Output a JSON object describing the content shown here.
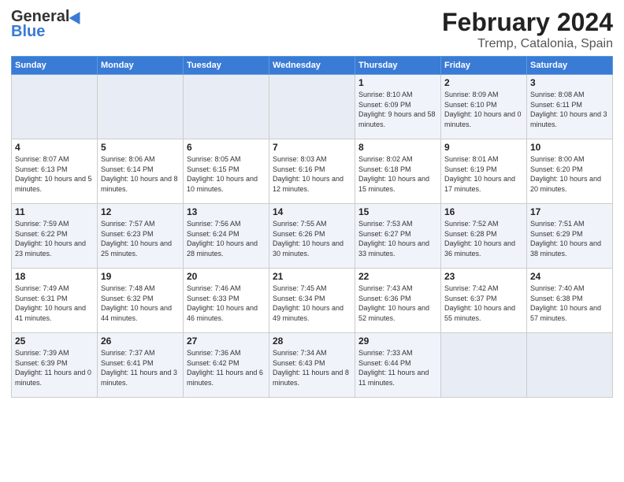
{
  "header": {
    "logo_general": "General",
    "logo_blue": "Blue",
    "title": "February 2024",
    "subtitle": "Tremp, Catalonia, Spain"
  },
  "days_of_week": [
    "Sunday",
    "Monday",
    "Tuesday",
    "Wednesday",
    "Thursday",
    "Friday",
    "Saturday"
  ],
  "weeks": [
    [
      {
        "day": "",
        "info": ""
      },
      {
        "day": "",
        "info": ""
      },
      {
        "day": "",
        "info": ""
      },
      {
        "day": "",
        "info": ""
      },
      {
        "day": "1",
        "info": "Sunrise: 8:10 AM\nSunset: 6:09 PM\nDaylight: 9 hours and 58 minutes."
      },
      {
        "day": "2",
        "info": "Sunrise: 8:09 AM\nSunset: 6:10 PM\nDaylight: 10 hours and 0 minutes."
      },
      {
        "day": "3",
        "info": "Sunrise: 8:08 AM\nSunset: 6:11 PM\nDaylight: 10 hours and 3 minutes."
      }
    ],
    [
      {
        "day": "4",
        "info": "Sunrise: 8:07 AM\nSunset: 6:13 PM\nDaylight: 10 hours and 5 minutes."
      },
      {
        "day": "5",
        "info": "Sunrise: 8:06 AM\nSunset: 6:14 PM\nDaylight: 10 hours and 8 minutes."
      },
      {
        "day": "6",
        "info": "Sunrise: 8:05 AM\nSunset: 6:15 PM\nDaylight: 10 hours and 10 minutes."
      },
      {
        "day": "7",
        "info": "Sunrise: 8:03 AM\nSunset: 6:16 PM\nDaylight: 10 hours and 12 minutes."
      },
      {
        "day": "8",
        "info": "Sunrise: 8:02 AM\nSunset: 6:18 PM\nDaylight: 10 hours and 15 minutes."
      },
      {
        "day": "9",
        "info": "Sunrise: 8:01 AM\nSunset: 6:19 PM\nDaylight: 10 hours and 17 minutes."
      },
      {
        "day": "10",
        "info": "Sunrise: 8:00 AM\nSunset: 6:20 PM\nDaylight: 10 hours and 20 minutes."
      }
    ],
    [
      {
        "day": "11",
        "info": "Sunrise: 7:59 AM\nSunset: 6:22 PM\nDaylight: 10 hours and 23 minutes."
      },
      {
        "day": "12",
        "info": "Sunrise: 7:57 AM\nSunset: 6:23 PM\nDaylight: 10 hours and 25 minutes."
      },
      {
        "day": "13",
        "info": "Sunrise: 7:56 AM\nSunset: 6:24 PM\nDaylight: 10 hours and 28 minutes."
      },
      {
        "day": "14",
        "info": "Sunrise: 7:55 AM\nSunset: 6:26 PM\nDaylight: 10 hours and 30 minutes."
      },
      {
        "day": "15",
        "info": "Sunrise: 7:53 AM\nSunset: 6:27 PM\nDaylight: 10 hours and 33 minutes."
      },
      {
        "day": "16",
        "info": "Sunrise: 7:52 AM\nSunset: 6:28 PM\nDaylight: 10 hours and 36 minutes."
      },
      {
        "day": "17",
        "info": "Sunrise: 7:51 AM\nSunset: 6:29 PM\nDaylight: 10 hours and 38 minutes."
      }
    ],
    [
      {
        "day": "18",
        "info": "Sunrise: 7:49 AM\nSunset: 6:31 PM\nDaylight: 10 hours and 41 minutes."
      },
      {
        "day": "19",
        "info": "Sunrise: 7:48 AM\nSunset: 6:32 PM\nDaylight: 10 hours and 44 minutes."
      },
      {
        "day": "20",
        "info": "Sunrise: 7:46 AM\nSunset: 6:33 PM\nDaylight: 10 hours and 46 minutes."
      },
      {
        "day": "21",
        "info": "Sunrise: 7:45 AM\nSunset: 6:34 PM\nDaylight: 10 hours and 49 minutes."
      },
      {
        "day": "22",
        "info": "Sunrise: 7:43 AM\nSunset: 6:36 PM\nDaylight: 10 hours and 52 minutes."
      },
      {
        "day": "23",
        "info": "Sunrise: 7:42 AM\nSunset: 6:37 PM\nDaylight: 10 hours and 55 minutes."
      },
      {
        "day": "24",
        "info": "Sunrise: 7:40 AM\nSunset: 6:38 PM\nDaylight: 10 hours and 57 minutes."
      }
    ],
    [
      {
        "day": "25",
        "info": "Sunrise: 7:39 AM\nSunset: 6:39 PM\nDaylight: 11 hours and 0 minutes."
      },
      {
        "day": "26",
        "info": "Sunrise: 7:37 AM\nSunset: 6:41 PM\nDaylight: 11 hours and 3 minutes."
      },
      {
        "day": "27",
        "info": "Sunrise: 7:36 AM\nSunset: 6:42 PM\nDaylight: 11 hours and 6 minutes."
      },
      {
        "day": "28",
        "info": "Sunrise: 7:34 AM\nSunset: 6:43 PM\nDaylight: 11 hours and 8 minutes."
      },
      {
        "day": "29",
        "info": "Sunrise: 7:33 AM\nSunset: 6:44 PM\nDaylight: 11 hours and 11 minutes."
      },
      {
        "day": "",
        "info": ""
      },
      {
        "day": "",
        "info": ""
      }
    ]
  ]
}
